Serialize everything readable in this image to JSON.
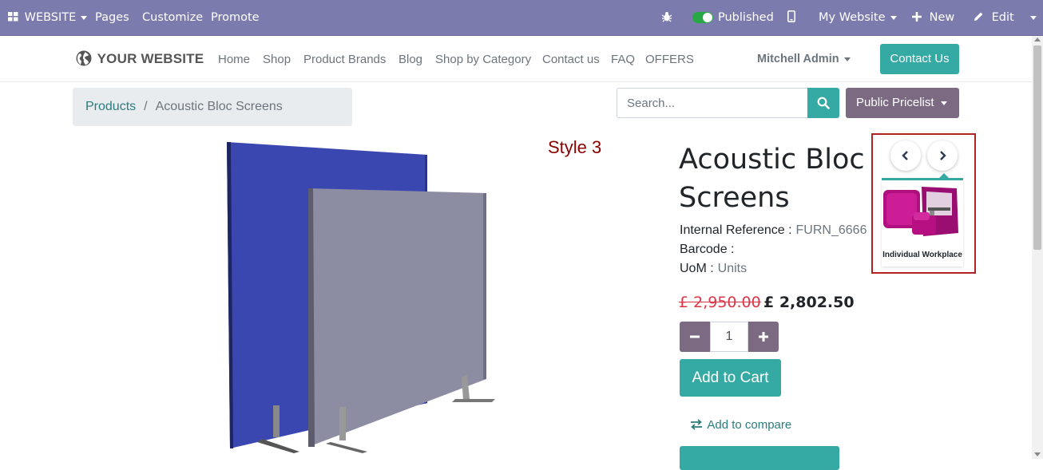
{
  "admin_bar": {
    "apps_label": "WEBSITE",
    "menu": [
      "Pages",
      "Customize",
      "Promote"
    ],
    "published_label": "Published",
    "website_selector": "My Website",
    "new_label": "New",
    "edit_label": "Edit"
  },
  "navbar": {
    "logo": "YOUR WEBSITE",
    "links": [
      "Home",
      "Shop",
      "Product Brands",
      "Blog",
      "Shop by Category",
      "Contact us",
      "FAQ",
      "OFFERS"
    ],
    "user": "Mitchell Admin",
    "contact_button": "Contact Us"
  },
  "breadcrumb": {
    "parent": "Products",
    "current": "Acoustic Bloc Screens"
  },
  "search": {
    "placeholder": "Search..."
  },
  "pricelist": {
    "label": "Public Pricelist"
  },
  "style_label": "Style 3",
  "product": {
    "title": "Acoustic Bloc Screens",
    "internal_reference_label": "Internal Reference :",
    "internal_reference": "FURN_6666",
    "barcode_label": "Barcode :",
    "barcode": "",
    "uom_label": "UoM :",
    "uom": "Units",
    "old_price": "£ 2,950.00",
    "price": "£ 2,802.50",
    "quantity": "1",
    "add_to_cart": "Add to Cart",
    "add_to_compare": "Add to compare"
  },
  "alternative_products": {
    "items": [
      {
        "name": "Individual Workplace"
      }
    ]
  },
  "colors": {
    "admin_bar": "#7c7bad",
    "primary": "#35a9a3",
    "secondary": "#7c6a82",
    "old_price": "#dc3545",
    "highlight_border": "#b22222"
  },
  "icons": {
    "apps": "grid-icon",
    "debug": "bug-icon",
    "mobile": "mobile-icon",
    "new": "plus-icon",
    "edit": "pencil-icon",
    "search": "search-icon",
    "compare": "exchange-icon",
    "carousel_prev": "chevron-left-icon",
    "carousel_next": "chevron-right-icon"
  }
}
